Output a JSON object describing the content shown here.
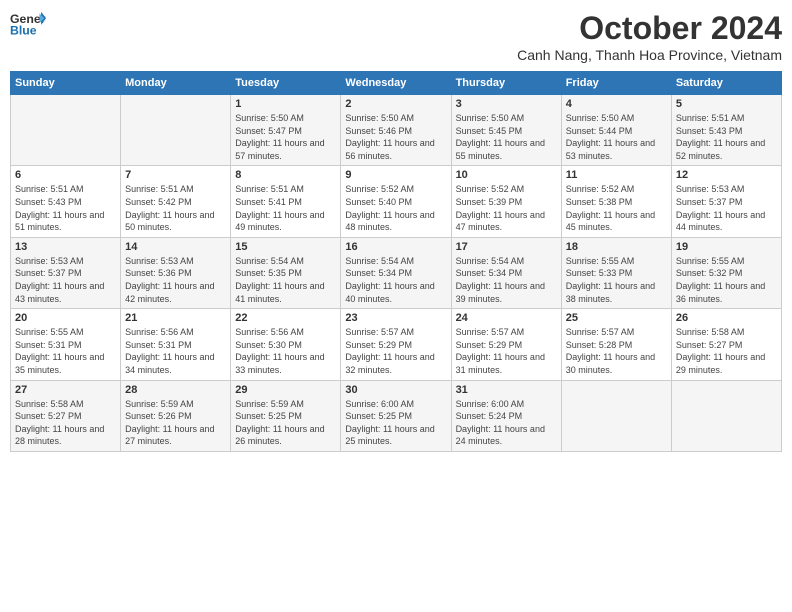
{
  "header": {
    "logo_general": "General",
    "logo_blue": "Blue",
    "month": "October 2024",
    "location": "Canh Nang, Thanh Hoa Province, Vietnam"
  },
  "days_of_week": [
    "Sunday",
    "Monday",
    "Tuesday",
    "Wednesday",
    "Thursday",
    "Friday",
    "Saturday"
  ],
  "weeks": [
    [
      {
        "day": "",
        "sunrise": "",
        "sunset": "",
        "daylight": ""
      },
      {
        "day": "",
        "sunrise": "",
        "sunset": "",
        "daylight": ""
      },
      {
        "day": "1",
        "sunrise": "Sunrise: 5:50 AM",
        "sunset": "Sunset: 5:47 PM",
        "daylight": "Daylight: 11 hours and 57 minutes."
      },
      {
        "day": "2",
        "sunrise": "Sunrise: 5:50 AM",
        "sunset": "Sunset: 5:46 PM",
        "daylight": "Daylight: 11 hours and 56 minutes."
      },
      {
        "day": "3",
        "sunrise": "Sunrise: 5:50 AM",
        "sunset": "Sunset: 5:45 PM",
        "daylight": "Daylight: 11 hours and 55 minutes."
      },
      {
        "day": "4",
        "sunrise": "Sunrise: 5:50 AM",
        "sunset": "Sunset: 5:44 PM",
        "daylight": "Daylight: 11 hours and 53 minutes."
      },
      {
        "day": "5",
        "sunrise": "Sunrise: 5:51 AM",
        "sunset": "Sunset: 5:43 PM",
        "daylight": "Daylight: 11 hours and 52 minutes."
      }
    ],
    [
      {
        "day": "6",
        "sunrise": "Sunrise: 5:51 AM",
        "sunset": "Sunset: 5:43 PM",
        "daylight": "Daylight: 11 hours and 51 minutes."
      },
      {
        "day": "7",
        "sunrise": "Sunrise: 5:51 AM",
        "sunset": "Sunset: 5:42 PM",
        "daylight": "Daylight: 11 hours and 50 minutes."
      },
      {
        "day": "8",
        "sunrise": "Sunrise: 5:51 AM",
        "sunset": "Sunset: 5:41 PM",
        "daylight": "Daylight: 11 hours and 49 minutes."
      },
      {
        "day": "9",
        "sunrise": "Sunrise: 5:52 AM",
        "sunset": "Sunset: 5:40 PM",
        "daylight": "Daylight: 11 hours and 48 minutes."
      },
      {
        "day": "10",
        "sunrise": "Sunrise: 5:52 AM",
        "sunset": "Sunset: 5:39 PM",
        "daylight": "Daylight: 11 hours and 47 minutes."
      },
      {
        "day": "11",
        "sunrise": "Sunrise: 5:52 AM",
        "sunset": "Sunset: 5:38 PM",
        "daylight": "Daylight: 11 hours and 45 minutes."
      },
      {
        "day": "12",
        "sunrise": "Sunrise: 5:53 AM",
        "sunset": "Sunset: 5:37 PM",
        "daylight": "Daylight: 11 hours and 44 minutes."
      }
    ],
    [
      {
        "day": "13",
        "sunrise": "Sunrise: 5:53 AM",
        "sunset": "Sunset: 5:37 PM",
        "daylight": "Daylight: 11 hours and 43 minutes."
      },
      {
        "day": "14",
        "sunrise": "Sunrise: 5:53 AM",
        "sunset": "Sunset: 5:36 PM",
        "daylight": "Daylight: 11 hours and 42 minutes."
      },
      {
        "day": "15",
        "sunrise": "Sunrise: 5:54 AM",
        "sunset": "Sunset: 5:35 PM",
        "daylight": "Daylight: 11 hours and 41 minutes."
      },
      {
        "day": "16",
        "sunrise": "Sunrise: 5:54 AM",
        "sunset": "Sunset: 5:34 PM",
        "daylight": "Daylight: 11 hours and 40 minutes."
      },
      {
        "day": "17",
        "sunrise": "Sunrise: 5:54 AM",
        "sunset": "Sunset: 5:34 PM",
        "daylight": "Daylight: 11 hours and 39 minutes."
      },
      {
        "day": "18",
        "sunrise": "Sunrise: 5:55 AM",
        "sunset": "Sunset: 5:33 PM",
        "daylight": "Daylight: 11 hours and 38 minutes."
      },
      {
        "day": "19",
        "sunrise": "Sunrise: 5:55 AM",
        "sunset": "Sunset: 5:32 PM",
        "daylight": "Daylight: 11 hours and 36 minutes."
      }
    ],
    [
      {
        "day": "20",
        "sunrise": "Sunrise: 5:55 AM",
        "sunset": "Sunset: 5:31 PM",
        "daylight": "Daylight: 11 hours and 35 minutes."
      },
      {
        "day": "21",
        "sunrise": "Sunrise: 5:56 AM",
        "sunset": "Sunset: 5:31 PM",
        "daylight": "Daylight: 11 hours and 34 minutes."
      },
      {
        "day": "22",
        "sunrise": "Sunrise: 5:56 AM",
        "sunset": "Sunset: 5:30 PM",
        "daylight": "Daylight: 11 hours and 33 minutes."
      },
      {
        "day": "23",
        "sunrise": "Sunrise: 5:57 AM",
        "sunset": "Sunset: 5:29 PM",
        "daylight": "Daylight: 11 hours and 32 minutes."
      },
      {
        "day": "24",
        "sunrise": "Sunrise: 5:57 AM",
        "sunset": "Sunset: 5:29 PM",
        "daylight": "Daylight: 11 hours and 31 minutes."
      },
      {
        "day": "25",
        "sunrise": "Sunrise: 5:57 AM",
        "sunset": "Sunset: 5:28 PM",
        "daylight": "Daylight: 11 hours and 30 minutes."
      },
      {
        "day": "26",
        "sunrise": "Sunrise: 5:58 AM",
        "sunset": "Sunset: 5:27 PM",
        "daylight": "Daylight: 11 hours and 29 minutes."
      }
    ],
    [
      {
        "day": "27",
        "sunrise": "Sunrise: 5:58 AM",
        "sunset": "Sunset: 5:27 PM",
        "daylight": "Daylight: 11 hours and 28 minutes."
      },
      {
        "day": "28",
        "sunrise": "Sunrise: 5:59 AM",
        "sunset": "Sunset: 5:26 PM",
        "daylight": "Daylight: 11 hours and 27 minutes."
      },
      {
        "day": "29",
        "sunrise": "Sunrise: 5:59 AM",
        "sunset": "Sunset: 5:25 PM",
        "daylight": "Daylight: 11 hours and 26 minutes."
      },
      {
        "day": "30",
        "sunrise": "Sunrise: 6:00 AM",
        "sunset": "Sunset: 5:25 PM",
        "daylight": "Daylight: 11 hours and 25 minutes."
      },
      {
        "day": "31",
        "sunrise": "Sunrise: 6:00 AM",
        "sunset": "Sunset: 5:24 PM",
        "daylight": "Daylight: 11 hours and 24 minutes."
      },
      {
        "day": "",
        "sunrise": "",
        "sunset": "",
        "daylight": ""
      },
      {
        "day": "",
        "sunrise": "",
        "sunset": "",
        "daylight": ""
      }
    ]
  ]
}
